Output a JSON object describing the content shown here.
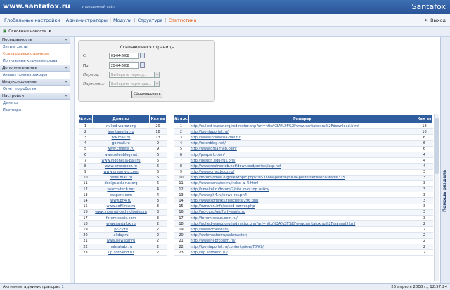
{
  "header": {
    "site": "www.santafox.ru",
    "subtitle": "упрощенный сайт",
    "brand": "Santafox"
  },
  "menu": [
    {
      "label": "Глобальные настройки",
      "active": false
    },
    {
      "label": "Администраторы",
      "active": false
    },
    {
      "label": "Модули",
      "active": false
    },
    {
      "label": "Структура",
      "active": false
    },
    {
      "label": "Статистика",
      "active": true
    }
  ],
  "exit_label": "Выход",
  "toolbar": {
    "label": "Основные новости"
  },
  "sidebar": {
    "sections": [
      {
        "title": "Посещаемость",
        "items": [
          {
            "label": "Хиты и хосты",
            "active": false
          },
          {
            "label": "Ссылающиеся страницы",
            "active": true
          },
          {
            "label": "Популярные ключевые слова",
            "active": false
          }
        ]
      },
      {
        "title": "Дополнительные",
        "items": [
          {
            "label": "Анализ прямых заходов",
            "active": false
          }
        ]
      },
      {
        "title": "Индексирование",
        "items": [
          {
            "label": "Отчет по роботам",
            "active": false
          }
        ]
      },
      {
        "title": "Настройки",
        "items": [
          {
            "label": "Домены",
            "active": false
          },
          {
            "label": "Партнеры",
            "active": false
          }
        ]
      }
    ]
  },
  "form": {
    "title": "Ссылающиеся страницы",
    "from_label": "С:",
    "from_value": "01-04-2008",
    "to_label": "По:",
    "to_value": "25-04-2008",
    "period_label": "Период:",
    "period_placeholder": "Выберите период...",
    "partners_label": "Партнеры:",
    "partners_placeholder": "Выберите партнера...",
    "submit_label": "Сформировать"
  },
  "domains_table": {
    "headers": [
      "№ п.п.",
      "Домены",
      "Кол-во"
    ],
    "rows": [
      [
        "1",
        "nulled-warez.org",
        "20"
      ],
      [
        "2",
        "ipontaportal.ru",
        "18"
      ],
      [
        "3",
        "ww.mail.ru",
        "13"
      ],
      [
        "4",
        "go.mail.ru",
        "9"
      ],
      [
        "5",
        "www.cmeltel.ru",
        "9"
      ],
      [
        "6",
        "www.relenblog.net",
        "6"
      ],
      [
        "7",
        "www.indonesia-bali.ru",
        "6"
      ],
      [
        "8",
        "www.cmexbooz.ru",
        "6"
      ],
      [
        "9",
        "www.dreamvip.com",
        "6"
      ],
      [
        "10",
        "news.mail.ru",
        "6"
      ],
      [
        "11",
        "design.edu-rus.org",
        "6"
      ],
      [
        "12",
        "search-tech.net",
        "4"
      ],
      [
        "13",
        "paspark.com",
        "4"
      ],
      [
        "14",
        "www.ph4.ru",
        "3"
      ],
      [
        "15",
        "www.softlinks.ru",
        "3"
      ],
      [
        "16",
        "www.internet-technologies.ru",
        "3"
      ],
      [
        "17",
        "forum.sewis.com",
        "3"
      ],
      [
        "18",
        "www.santafox.ru",
        "2"
      ],
      [
        "19",
        "pc-cy.ru",
        "2"
      ],
      [
        "20",
        "allday.ru",
        "2"
      ],
      [
        "21",
        "www.newscar.ru",
        "2"
      ],
      [
        "22",
        "habrahabr.ru",
        "2"
      ],
      [
        "23",
        "up.sotbiend.ru",
        "2"
      ]
    ]
  },
  "referers_table": {
    "headers": [
      "№ п.п.",
      "Реферер",
      "Кол-во"
    ],
    "rows": [
      [
        "1",
        "http://nulled-warez.org/redirector.php?url=http%3A%2F%2Fwww.santafox.ru%2Fdownload.html",
        "18"
      ],
      [
        "2",
        "http://ipontaportal.ru/",
        "16"
      ],
      [
        "3",
        "http://www.indonesia-bali.ru/",
        "6"
      ],
      [
        "4",
        "http://relenblog.net/",
        "6"
      ],
      [
        "5",
        "http://www.dreamvip.com/",
        "6"
      ],
      [
        "6",
        "http://paspark.com/",
        "4"
      ],
      [
        "7",
        "http://design.edu-rus.org/",
        "4"
      ],
      [
        "8",
        "http://www.realnosteb.net/download/scripts/asp.net",
        "4"
      ],
      [
        "9",
        "http://www.cmexbooz.ru/",
        "3"
      ],
      [
        "10",
        "http://forum.cmeli.org/viewtopic.php?t=53388&postdays=0&postorder=asc&start=315",
        "3"
      ],
      [
        "11",
        "http://www.santafox.ru/index_a_4.html",
        "3"
      ],
      [
        "12",
        "http://cmeltel.ru/forum/2/site_dvo_top_asiko/",
        "3"
      ],
      [
        "13",
        "http://www.ph4.ru/news_rss.ph4",
        "3"
      ],
      [
        "14",
        "http://www.softlinks.ru/scripts/296.php",
        "3"
      ],
      [
        "15",
        "http://uznarsn.info/speed_server.php",
        "3"
      ],
      [
        "16",
        "http://pc-cy.ru/go/?url=santa.ru",
        "3"
      ],
      [
        "17",
        "http://forum.sebus.com.ru/",
        "3"
      ],
      [
        "18",
        "http://nulled-warez.org/redirector.php?url=http%3A%2F%2Fwww.santafox.ru%2Fmanual.html",
        "2"
      ],
      [
        "19",
        "http://www.cmeltel.ru/",
        "2"
      ],
      [
        "20",
        "http://webmaster.ru/webmaster/",
        "2"
      ],
      [
        "21",
        "http://www.neproblem.ru/",
        "2"
      ],
      [
        "22",
        "http://ipontaportal.ru/content/view/70/69/",
        "2"
      ],
      [
        "23",
        "http://up.sotbiend.ru/",
        "2"
      ]
    ]
  },
  "status": {
    "left": "Активные администраторы:",
    "admin_count": "1",
    "right": "25 апреля 2008 г., 12:57:24"
  },
  "help_label": "Помощь раздела"
}
